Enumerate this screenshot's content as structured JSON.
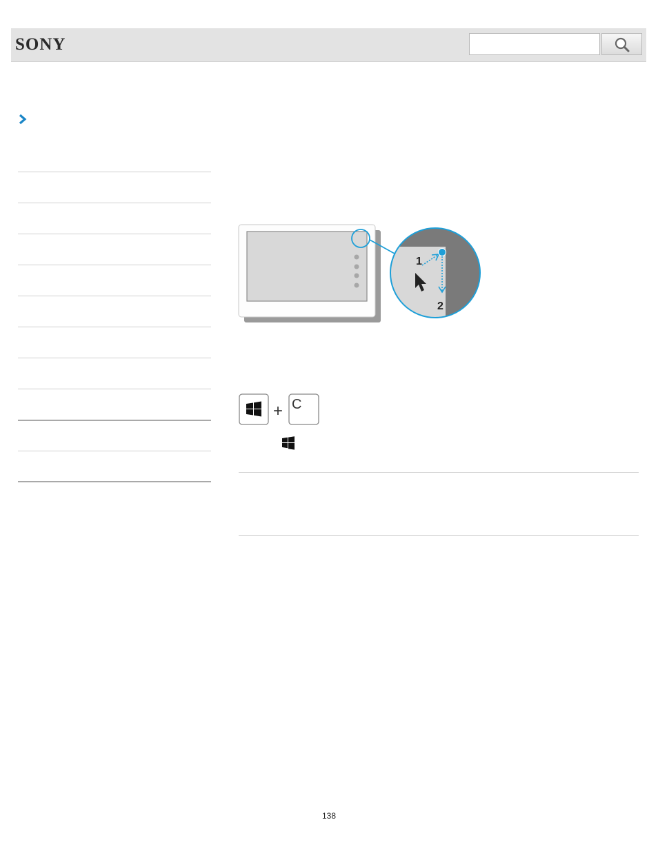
{
  "header": {
    "logo": "SONY",
    "search": {
      "value": "",
      "placeholder": ""
    },
    "search_icon": "magnifier-icon"
  },
  "breadcrumb": {
    "icon": "chevron-right-icon"
  },
  "sidebar": {
    "item_count": 10
  },
  "illustration": {
    "callout_label_1": "1",
    "callout_label_2": "2"
  },
  "key_combo": {
    "plus": "+",
    "key_c": "C",
    "windows_key_icon": "windows-logo-icon"
  },
  "footer": {
    "page_number": "138"
  },
  "colors": {
    "header_bg": "#e3e3e3",
    "accent_blue": "#1e9fd8",
    "breadcrumb_blue": "#1b86c7"
  }
}
